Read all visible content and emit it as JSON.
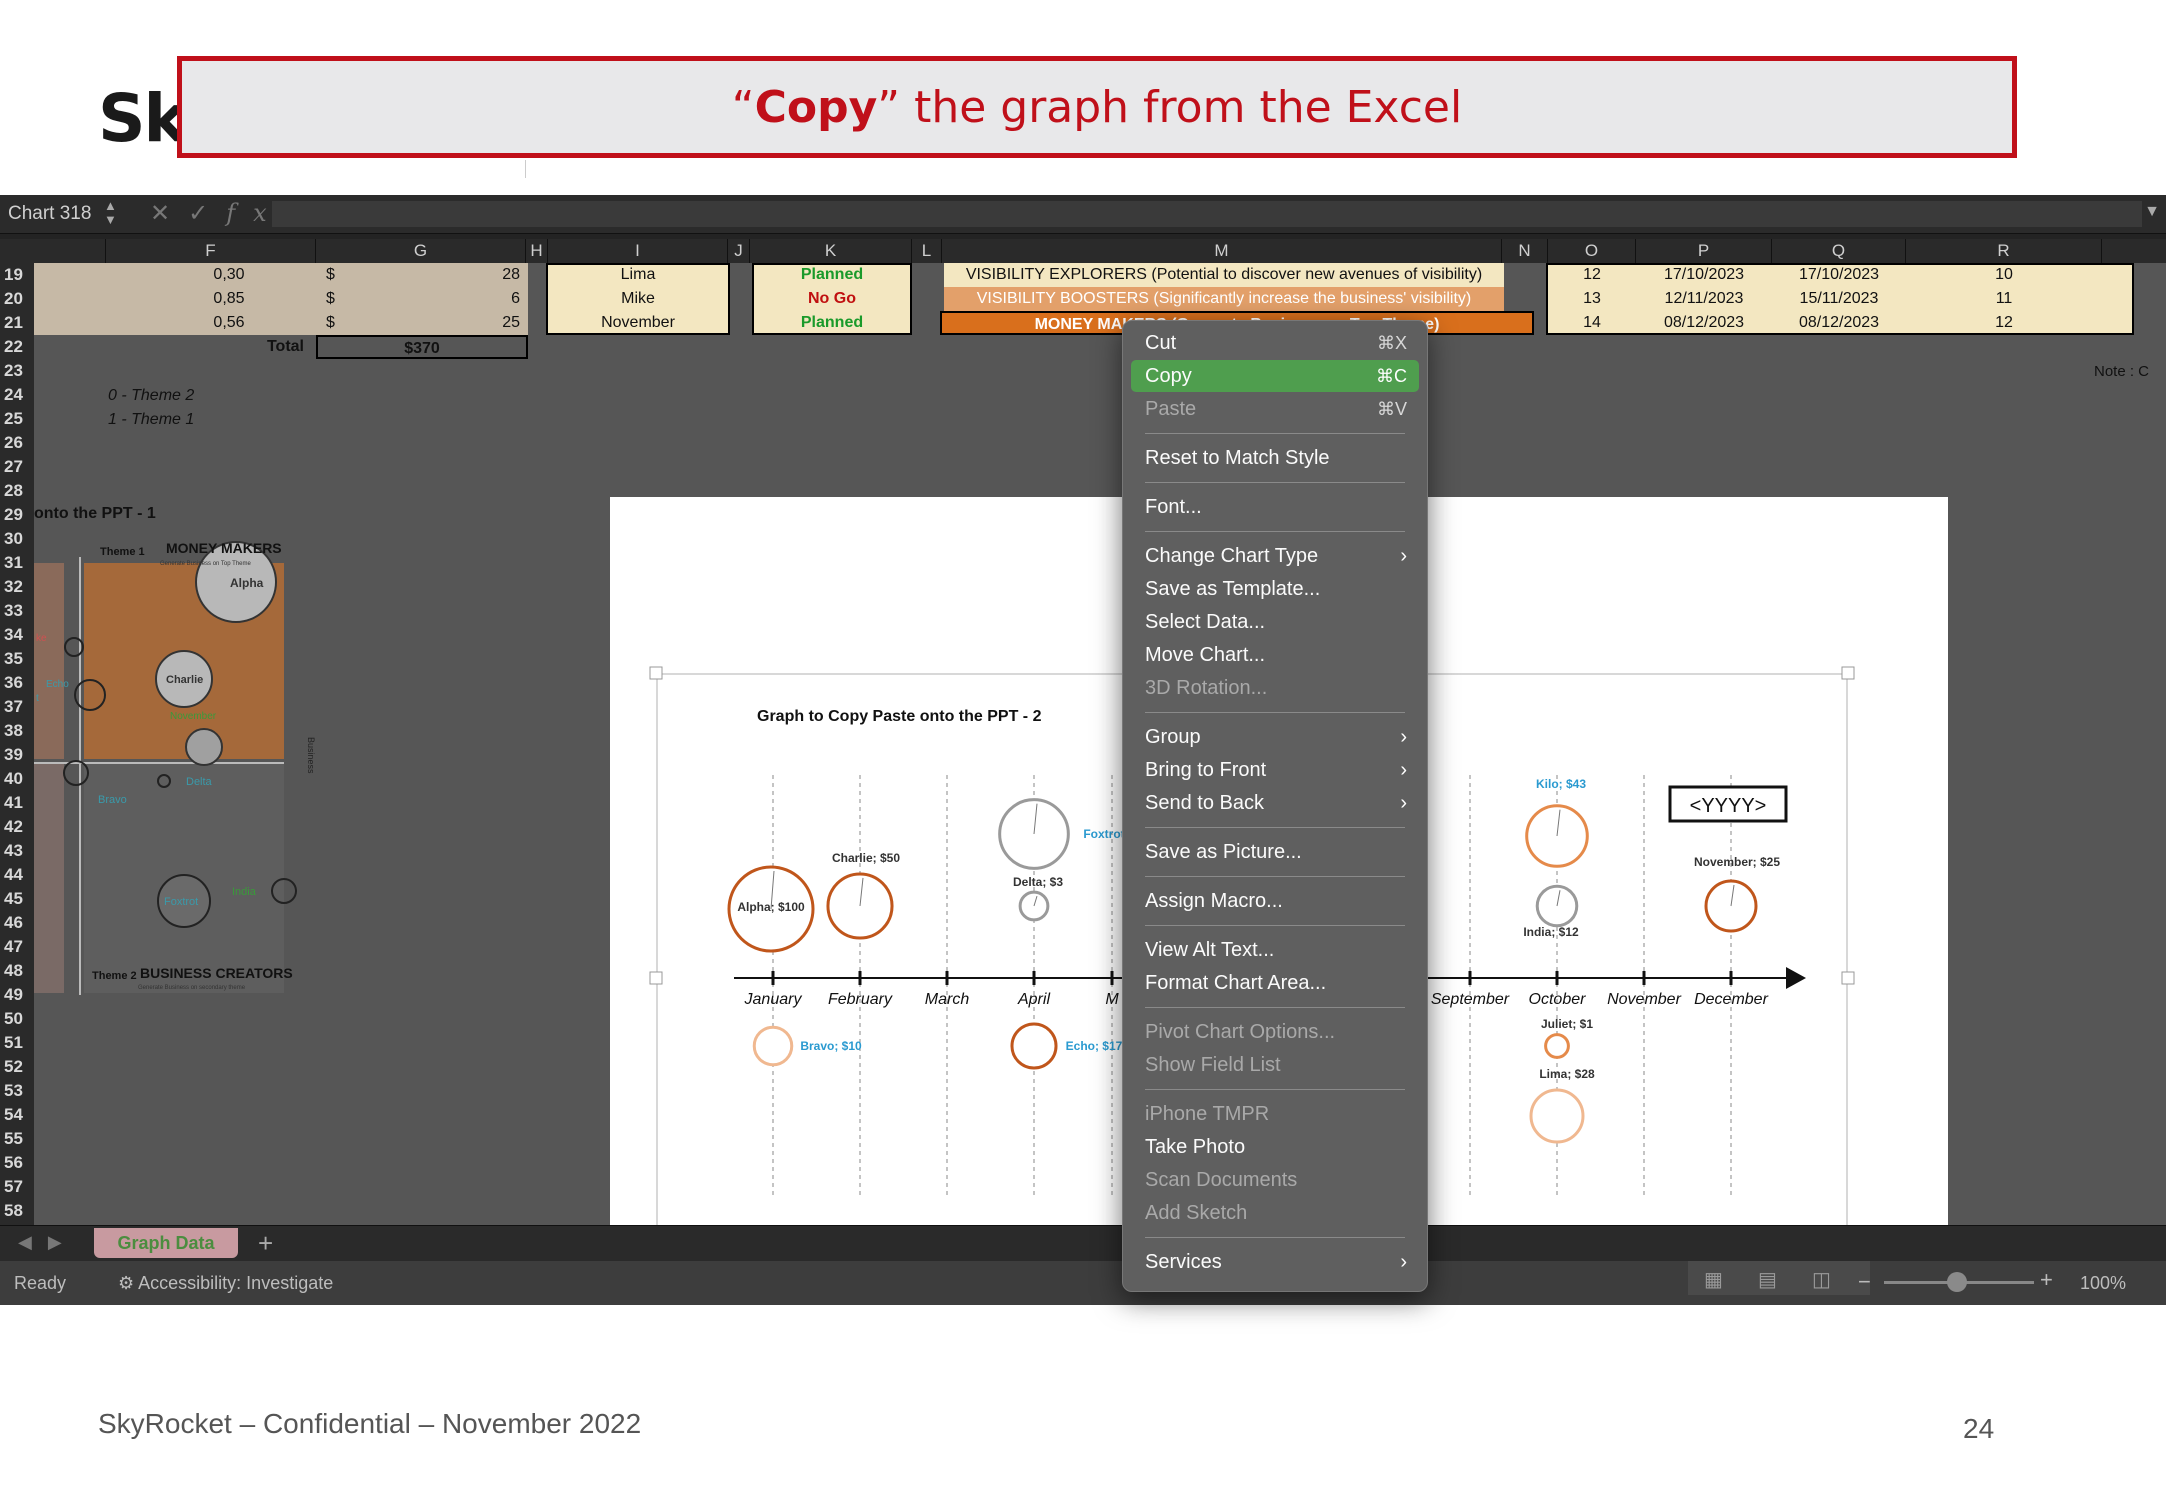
{
  "slide": {
    "logo_text": "Sk",
    "banner_quote_open": "“",
    "banner_bold": "Copy",
    "banner_rest": "” the graph from the Excel",
    "footer": "SkyRocket – Confidential – November 2022",
    "page_number": "24"
  },
  "excel": {
    "name_box": "Chart 318",
    "fx_label": "fx",
    "columns": [
      "F",
      "G",
      "H",
      "I",
      "J",
      "K",
      "L",
      "M",
      "N",
      "O",
      "P",
      "Q",
      "R"
    ],
    "rows": [
      "19",
      "20",
      "21",
      "22",
      "23",
      "24",
      "25",
      "26",
      "27",
      "28",
      "29",
      "30",
      "31",
      "32",
      "33",
      "34",
      "35",
      "36",
      "37",
      "38",
      "39",
      "40",
      "41",
      "42",
      "43",
      "44",
      "45",
      "46",
      "47",
      "48",
      "49",
      "50",
      "51",
      "52",
      "53",
      "54",
      "55",
      "56",
      "57",
      "58"
    ],
    "table": [
      {
        "f": "0,30",
        "g_cur": "$",
        "g": "28",
        "i": "Lima",
        "k": "Planned",
        "m": "VISIBILITY EXPLORERS (Potential to discover new avenues of visibility)",
        "o": "12",
        "p": "17/10/2023",
        "q": "17/10/2023",
        "r": "10"
      },
      {
        "f": "0,85",
        "g_cur": "$",
        "g": "6",
        "i": "Mike",
        "k": "No Go",
        "m": "VISIBILITY BOOSTERS (Significantly increase the business' visibility)",
        "o": "13",
        "p": "12/11/2023",
        "q": "15/11/2023",
        "r": "11"
      },
      {
        "f": "0,56",
        "g_cur": "$",
        "g": "25",
        "i": "November",
        "k": "Planned",
        "m": "MONEY MAKERS (Generate Business on Top Theme)",
        "o": "14",
        "p": "08/12/2023",
        "q": "08/12/2023",
        "r": "12"
      }
    ],
    "total_label": "Total",
    "total_value": "$370",
    "note": "Note : C",
    "theme_legend": [
      "0 - Theme 2",
      "1 - Theme 1"
    ],
    "left_chart_title": "onto the PPT - 1",
    "sheet_tab": "Graph Data",
    "status_ready": "Ready",
    "status_accessibility": "Accessibility: Investigate",
    "zoom": "100%"
  },
  "quadrant": {
    "theme_top": "Theme 1",
    "theme_bottom": "Theme 2",
    "top_label": "MONEY MAKERS",
    "top_sub": "Generate Business on Top Theme",
    "bottom_label": "BUSINESS CREATORS",
    "bottom_sub": "Generate Business on secondary theme",
    "right_axis": "Business",
    "labels": [
      "Alpha",
      "Charlie",
      "November",
      "Echo",
      "Bravo",
      "Delta",
      "Foxtrot",
      "India",
      "ke",
      "t"
    ]
  },
  "timeline": {
    "title": "Graph to Copy Paste onto the PPT - 2",
    "year_placeholder": "<YYYY>",
    "months": [
      "January",
      "February",
      "March",
      "April",
      "M",
      "September",
      "October",
      "November",
      "December"
    ],
    "above": [
      {
        "label": "Alpha; $100",
        "month": "January",
        "value": 100,
        "color": "#c0561b"
      },
      {
        "label": "Charlie; $50",
        "month": "February",
        "value": 50,
        "color": "#c0561b"
      },
      {
        "label": "Delta; $3",
        "month": "April",
        "value": 3,
        "color": "#9a9a9a"
      },
      {
        "label": "Foxtrot",
        "month": "April",
        "value": 60,
        "color": "#9a9a9a"
      },
      {
        "label": "Kilo; $43",
        "month": "October",
        "value": 43,
        "color": "#e58a4a"
      },
      {
        "label": "India; $12",
        "month": "October",
        "value": 12,
        "color": "#9a9a9a"
      },
      {
        "label": "November; $25",
        "month": "December",
        "value": 25,
        "color": "#c0561b"
      }
    ],
    "below": [
      {
        "label": "Bravo; $10",
        "month": "January",
        "value": 10,
        "color": "#f0b890"
      },
      {
        "label": "Echo; $17",
        "month": "April",
        "value": 17,
        "color": "#c0561b"
      },
      {
        "label": "Juliet; $1",
        "month": "October",
        "value": 1,
        "color": "#e58a4a"
      },
      {
        "label": "Lima; $28",
        "month": "October",
        "value": 28,
        "color": "#f0b890"
      }
    ]
  },
  "context_menu": [
    {
      "label": "Cut",
      "shortcut": "⌘X",
      "state": "normal"
    },
    {
      "label": "Copy",
      "shortcut": "⌘C",
      "state": "selected"
    },
    {
      "label": "Paste",
      "shortcut": "⌘V",
      "state": "disabled"
    },
    {
      "sep": true
    },
    {
      "label": "Reset to Match Style",
      "state": "normal"
    },
    {
      "sep": true
    },
    {
      "label": "Font...",
      "state": "normal"
    },
    {
      "sep": true
    },
    {
      "label": "Change Chart Type",
      "state": "normal",
      "submenu": true
    },
    {
      "label": "Save as Template...",
      "state": "normal"
    },
    {
      "label": "Select Data...",
      "state": "normal"
    },
    {
      "label": "Move Chart...",
      "state": "normal"
    },
    {
      "label": "3D Rotation...",
      "state": "disabled"
    },
    {
      "sep": true
    },
    {
      "label": "Group",
      "state": "normal",
      "submenu": true
    },
    {
      "label": "Bring to Front",
      "state": "normal",
      "submenu": true
    },
    {
      "label": "Send to Back",
      "state": "normal",
      "submenu": true
    },
    {
      "sep": true
    },
    {
      "label": "Save as Picture...",
      "state": "normal"
    },
    {
      "sep": true
    },
    {
      "label": "Assign Macro...",
      "state": "normal"
    },
    {
      "sep": true
    },
    {
      "label": "View Alt Text...",
      "state": "normal"
    },
    {
      "label": "Format Chart Area...",
      "state": "normal"
    },
    {
      "sep": true
    },
    {
      "label": "Pivot Chart Options...",
      "state": "disabled"
    },
    {
      "label": "Show Field List",
      "state": "disabled"
    },
    {
      "sep": true
    },
    {
      "label": "iPhone TMPR",
      "state": "disabled"
    },
    {
      "label": "Take Photo",
      "state": "normal"
    },
    {
      "label": "Scan Documents",
      "state": "disabled"
    },
    {
      "label": "Add Sketch",
      "state": "disabled"
    },
    {
      "sep": true
    },
    {
      "label": "Services",
      "state": "normal",
      "submenu": true
    }
  ],
  "colors": {
    "banner_red": "#c0101a",
    "menu_highlight": "#4f9e4e",
    "orange": "#d96f1c"
  }
}
